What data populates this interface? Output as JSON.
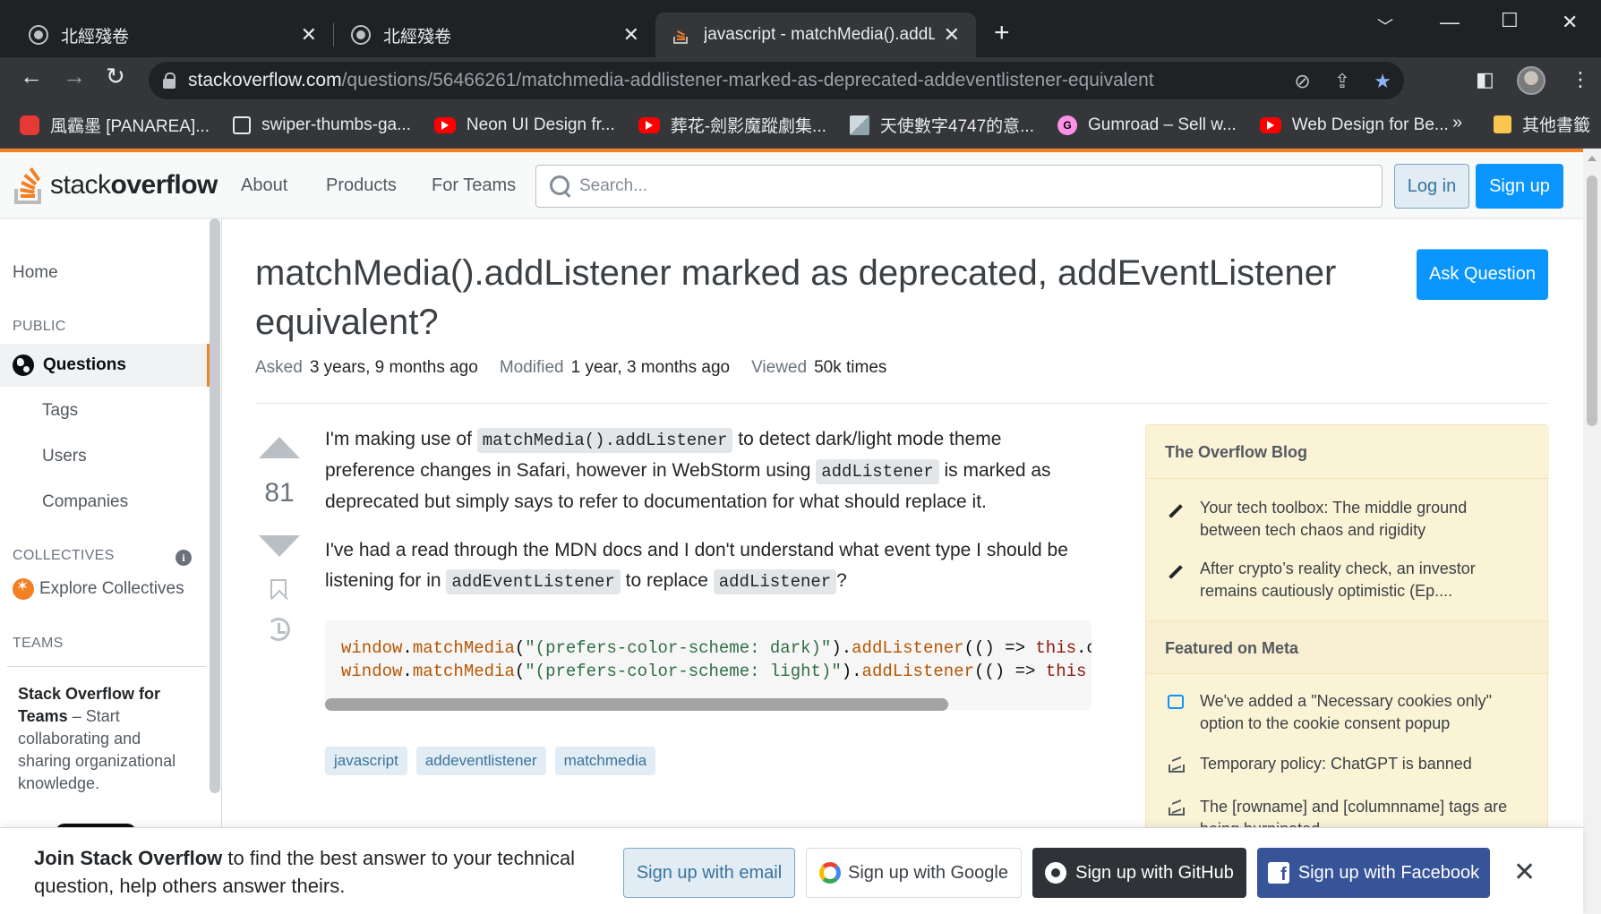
{
  "browser": {
    "tabs": [
      {
        "title": "北經殘卷"
      },
      {
        "title": "北經殘卷"
      },
      {
        "title": "javascript - matchMedia().addL"
      }
    ],
    "url_host": "stackoverflow.com",
    "url_path": "/questions/56466261/matchmedia-addlistener-marked-as-deprecated-addeventlistener-equivalent",
    "bookmarks": [
      {
        "label": "風靏墨 [PANAREA]...",
        "icon": "red-icon"
      },
      {
        "label": "swiper-thumbs-ga...",
        "icon": "page-icon"
      },
      {
        "label": "Neon UI Design fr...",
        "icon": "youtube-icon"
      },
      {
        "label": "葬花-劍影魔蹤劇集...",
        "icon": "youtube-icon"
      },
      {
        "label": "天使數字4747的意...",
        "icon": "image-icon"
      },
      {
        "label": "Gumroad – Sell w...",
        "icon": "gumroad-icon"
      },
      {
        "label": "Web Design for Be...",
        "icon": "youtube-icon"
      }
    ],
    "bookmarks_more": "»",
    "other_bookmarks": "其他書籤"
  },
  "so_header": {
    "logo_light": "stack",
    "logo_bold": "overflow",
    "nav": [
      "About",
      "Products",
      "For Teams"
    ],
    "search_placeholder": "Search...",
    "login": "Log in",
    "signup": "Sign up"
  },
  "sidebar": {
    "home": "Home",
    "public_heading": "PUBLIC",
    "questions": "Questions",
    "tags": "Tags",
    "users": "Users",
    "companies": "Companies",
    "collectives_heading": "COLLECTIVES",
    "explore_collectives": "Explore Collectives",
    "teams_heading": "TEAMS",
    "teams_title": "Stack Overflow for Teams",
    "teams_text": " – Start collaborating and sharing organizational knowledge."
  },
  "question": {
    "title": "matchMedia().addListener marked as deprecated, addEventListener equivalent?",
    "ask_button": "Ask Question",
    "asked_label": "Asked",
    "asked_value": "3 years, 9 months ago",
    "modified_label": "Modified",
    "modified_value": "1 year, 3 months ago",
    "viewed_label": "Viewed",
    "viewed_value": "50k times",
    "votes": "81",
    "p1_a": "I'm making use of ",
    "p1_code1": "matchMedia().addListener",
    "p1_b": " to detect dark/light mode theme preference changes in Safari, however in WebStorm using ",
    "p1_code2": "addListener",
    "p1_c": " is marked as deprecated but simply says to refer to documentation for what should replace it.",
    "p2_a": "I've had a read through the MDN docs and I don't understand what event type I should be listening for in ",
    "p2_code1": "addEventListener",
    "p2_b": " to replace ",
    "p2_code2": "addListener",
    "p2_c": "?",
    "code_line1": "window.matchMedia(\"(prefers-color-scheme: dark)\").addListener(() => this.c",
    "code_line2": "window.matchMedia(\"(prefers-color-scheme: light)\").addListener(() => this",
    "tags": [
      "javascript",
      "addeventlistener",
      "matchmedia"
    ]
  },
  "widget": {
    "blog_heading": "The Overflow Blog",
    "blog_items": [
      "Your tech toolbox: The middle ground between tech chaos and rigidity",
      "After crypto’s reality check, an investor remains cautiously optimistic (Ep...."
    ],
    "meta_heading": "Featured on Meta",
    "meta_items": [
      "We've added a \"Necessary cookies only\" option to the cookie consent popup",
      "Temporary policy: ChatGPT is banned",
      "The [rowname] and [columnname] tags are being burninated"
    ]
  },
  "banner": {
    "bold": "Join Stack Overflow",
    "text": " to find the best answer to your technical question, help others answer theirs.",
    "email": "Sign up with email",
    "google": "Sign up with Google",
    "github": "Sign up with GitHub",
    "facebook": "Sign up with Facebook"
  },
  "colors": {
    "so_orange": "#f48024",
    "so_blue": "#0a95ff",
    "chrome_dark": "#202124"
  }
}
